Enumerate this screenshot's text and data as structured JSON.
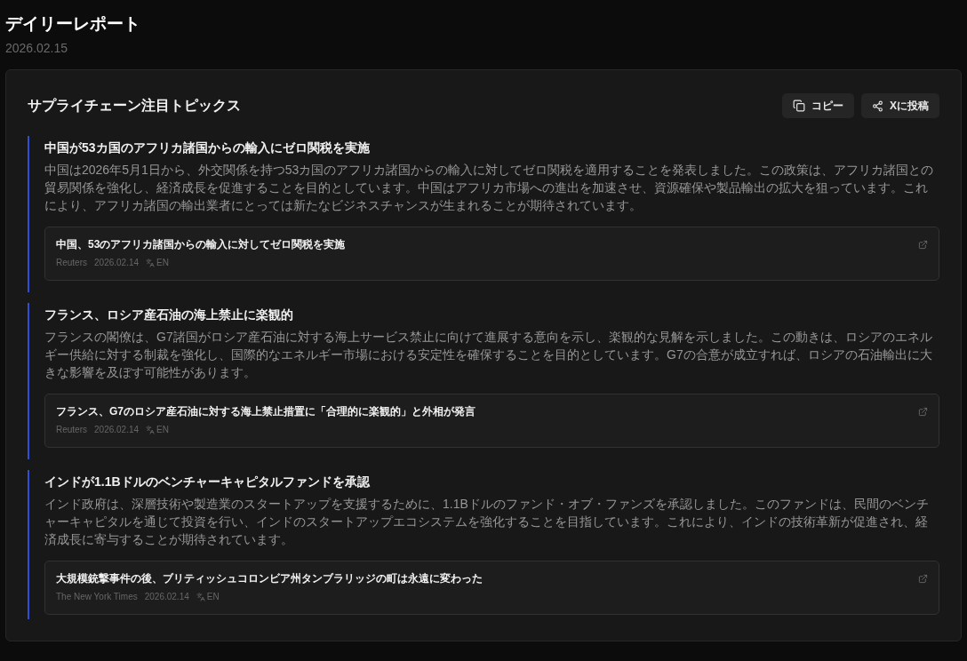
{
  "page": {
    "title": "デイリーレポート",
    "date": "2026.02.15"
  },
  "section": {
    "title": "サプライチェーン注目トピックス",
    "actions": [
      {
        "kind": "copy",
        "label": "コピー"
      },
      {
        "kind": "share",
        "label": "Xに投稿"
      }
    ],
    "topics": [
      {
        "title": "中国が53カ国のアフリカ諸国からの輸入にゼロ関税を実施",
        "summary": "中国は2026年5月1日から、外交関係を持つ53カ国のアフリカ諸国からの輸入に対してゼロ関税を適用することを発表しました。この政策は、アフリカ諸国との貿易関係を強化し、経済成長を促進することを目的としています。中国はアフリカ市場への進出を加速させ、資源確保や製品輸出の拡大を狙っています。これにより、アフリカ諸国の輸出業者にとっては新たなビジネスチャンスが生まれることが期待されています。",
        "source": {
          "headline": "中国、53のアフリカ諸国からの輸入に対してゼロ関税を実施",
          "publisher": "Reuters",
          "date": "2026.02.14",
          "language": "EN"
        }
      },
      {
        "title": "フランス、ロシア産石油の海上禁止に楽観的",
        "summary": "フランスの閣僚は、G7諸国がロシア産石油に対する海上サービス禁止に向けて進展する意向を示し、楽観的な見解を示しました。この動きは、ロシアのエネルギー供給に対する制裁を強化し、国際的なエネルギー市場における安定性を確保することを目的としています。G7の合意が成立すれば、ロシアの石油輸出に大きな影響を及ぼす可能性があります。",
        "source": {
          "headline": "フランス、G7のロシア産石油に対する海上禁止措置に「合理的に楽観的」と外相が発言",
          "publisher": "Reuters",
          "date": "2026.02.14",
          "language": "EN"
        }
      },
      {
        "title": "インドが1.1Bドルのベンチャーキャピタルファンドを承認",
        "summary": "インド政府は、深層技術や製造業のスタートアップを支援するために、1.1Bドルのファンド・オブ・ファンズを承認しました。このファンドは、民間のベンチャーキャピタルを通じて投資を行い、インドのスタートアップエコシステムを強化することを目指しています。これにより、インドの技術革新が促進され、経済成長に寄与することが期待されています。",
        "source": {
          "headline": "大規模銃撃事件の後、ブリティッシュコロンビア州タンブラリッジの町は永遠に変わった",
          "publisher": "The New York Times",
          "date": "2026.02.14",
          "language": "EN"
        }
      }
    ]
  }
}
